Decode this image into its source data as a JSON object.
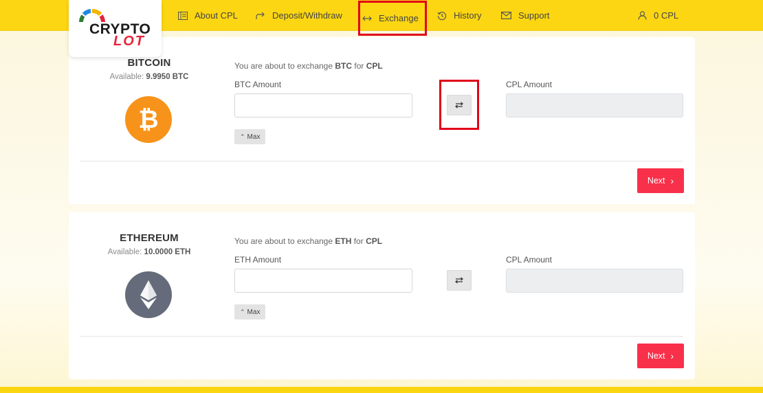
{
  "brand": {
    "line1": "CRYPTO",
    "line2": "LOT"
  },
  "nav": {
    "items": [
      {
        "label": "About CPL",
        "icon": "ledger-icon"
      },
      {
        "label": "Deposit/Withdraw",
        "icon": "redo-arrow-icon"
      },
      {
        "label": "Exchange",
        "icon": "left-right-arrow-icon",
        "highlighted": true
      },
      {
        "label": "History",
        "icon": "history-icon"
      },
      {
        "label": "Support",
        "icon": "envelope-icon"
      }
    ],
    "account_balance": "0 CPL",
    "account_icon": "user-icon"
  },
  "cards": [
    {
      "coin": "BITCOIN",
      "available_label": "Available:",
      "available_value": "9.9950 BTC",
      "icon": "bitcoin-icon",
      "icon_color": "#f7931a",
      "desc_prefix": "You are about to exchange",
      "from_code": "BTC",
      "desc_mid": "for",
      "to_code": "CPL",
      "from_label": "BTC Amount",
      "from_value": "",
      "to_label": "CPL Amount",
      "to_value": "",
      "max_label": "Max",
      "next_label": "Next"
    },
    {
      "coin": "ETHEREUM",
      "available_label": "Available:",
      "available_value": "10.0000 ETH",
      "icon": "ethereum-icon",
      "icon_color": "#656b7a",
      "desc_prefix": "You are about to exchange",
      "from_code": "ETH",
      "desc_mid": "for",
      "to_code": "CPL",
      "from_label": "ETH Amount",
      "from_value": "",
      "to_label": "CPL Amount",
      "to_value": "",
      "max_label": "Max",
      "next_label": "Next"
    }
  ],
  "colors": {
    "topbar": "#fcd612",
    "accent_red": "#f8304a",
    "highlight_red": "#e0001a"
  }
}
